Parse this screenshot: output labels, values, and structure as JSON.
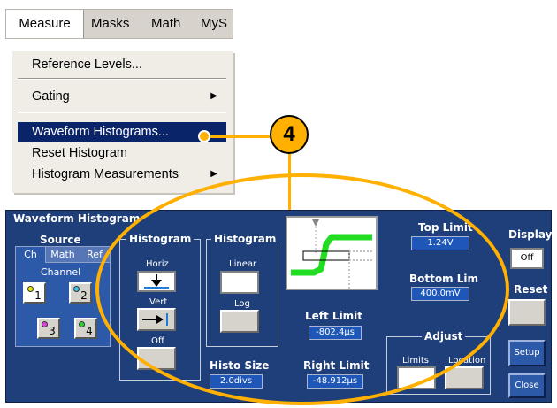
{
  "menubar": {
    "items": [
      "Measure",
      "Masks",
      "Math",
      "MyS"
    ]
  },
  "dropdown": {
    "reference_levels": "Reference Levels...",
    "gating": "Gating",
    "waveform_histograms": "Waveform Histograms...",
    "reset_histogram": "Reset Histogram",
    "histogram_measurements": "Histogram Measurements",
    "submenu_arrow": "▶"
  },
  "callout": {
    "number": "4"
  },
  "panel": {
    "title": "Waveform Histogram",
    "source": {
      "label": "Source",
      "tabs": [
        "Ch",
        "Math",
        "Ref"
      ],
      "channel_label": "Channel",
      "channels": [
        "1",
        "2",
        "3",
        "4"
      ]
    },
    "histogram_mode": {
      "label": "Histogram",
      "horiz": "Horiz",
      "vert": "Vert",
      "off": "Off"
    },
    "histogram_scale": {
      "label": "Histogram",
      "linear": "Linear",
      "log": "Log"
    },
    "histo_size": {
      "label": "Histo Size",
      "value": "2.0divs"
    },
    "left_limit": {
      "label": "Left Limit",
      "value": "-802.4µs"
    },
    "right_limit": {
      "label": "Right Limit",
      "value": "-48.912µs"
    },
    "top_limit": {
      "label": "Top Limit",
      "value": "1.24V"
    },
    "bottom_limit": {
      "label": "Bottom Lim",
      "value": "400.0mV"
    },
    "adjust": {
      "label": "Adjust",
      "limits": "Limits",
      "location": "Location"
    },
    "display": {
      "label": "Display",
      "value": "Off"
    },
    "reset": {
      "label": "Reset"
    },
    "setup": {
      "label": "Setup"
    },
    "close": {
      "label": "Close"
    }
  },
  "colors": {
    "panel_bg": "#1f3f7a",
    "callout": "#ffb000",
    "waveform": "#22dd22",
    "menu_highlight": "#0a246a"
  }
}
